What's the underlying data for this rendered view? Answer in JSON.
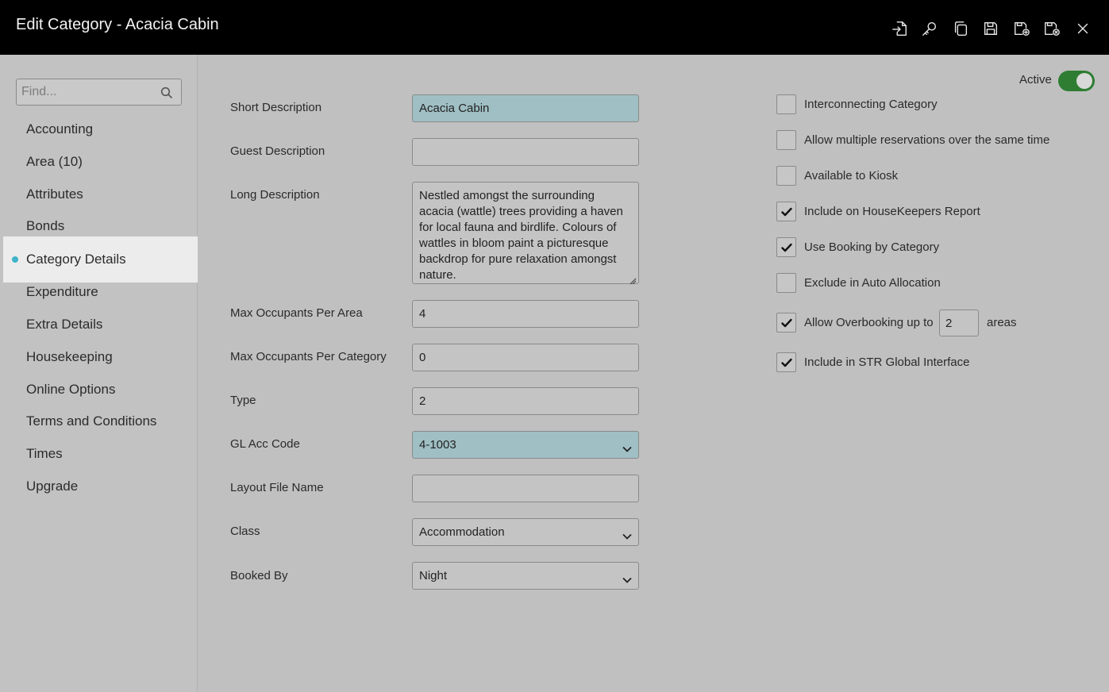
{
  "window": {
    "title": "Edit Category - Acacia Cabin"
  },
  "toolbar": {
    "icons": [
      "import-icon",
      "key-icon",
      "copy-icon",
      "save-icon",
      "save-and-new-icon",
      "save-and-close-icon",
      "close-icon"
    ]
  },
  "sidebar": {
    "search_placeholder": "Find...",
    "items": [
      {
        "label": "Accounting"
      },
      {
        "label": "Area (10)"
      },
      {
        "label": "Attributes"
      },
      {
        "label": "Bonds"
      },
      {
        "label": "Category Details",
        "active": true
      },
      {
        "label": "Expenditure"
      },
      {
        "label": "Extra Details"
      },
      {
        "label": "Housekeeping"
      },
      {
        "label": "Online Options"
      },
      {
        "label": "Terms and Conditions"
      },
      {
        "label": "Times"
      },
      {
        "label": "Upgrade"
      }
    ]
  },
  "form": {
    "short_description": {
      "label": "Short Description",
      "value": "Acacia Cabin"
    },
    "guest_description": {
      "label": "Guest Description",
      "value": ""
    },
    "long_description": {
      "label": "Long Description",
      "value": "Nestled amongst the surrounding acacia (wattle) trees providing a haven for local fauna and birdlife. Colours of wattles in bloom paint a picturesque backdrop for pure relaxation amongst nature."
    },
    "max_occupants_area": {
      "label": "Max Occupants Per Area",
      "value": "4"
    },
    "max_occupants_category": {
      "label": "Max Occupants Per Category",
      "value": "0"
    },
    "type": {
      "label": "Type",
      "value": "2"
    },
    "gl_acc_code": {
      "label": "GL Acc Code",
      "value": "4-1003"
    },
    "layout_file_name": {
      "label": "Layout File Name",
      "value": ""
    },
    "class": {
      "label": "Class",
      "value": "Accommodation"
    },
    "booked_by": {
      "label": "Booked By",
      "value": "Night"
    }
  },
  "options": {
    "active": {
      "label": "Active",
      "on": true
    },
    "interconnecting": {
      "label": "Interconnecting Category",
      "checked": false
    },
    "allow_multiple": {
      "label": "Allow multiple reservations over the same time",
      "checked": false
    },
    "kiosk": {
      "label": "Available to Kiosk",
      "checked": false
    },
    "housekeepers": {
      "label": "Include on HouseKeepers Report",
      "checked": true
    },
    "booking_by_category": {
      "label": "Use Booking by Category",
      "checked": true
    },
    "exclude_auto": {
      "label": "Exclude in Auto Allocation",
      "checked": false
    },
    "overbooking": {
      "label": "Allow Overbooking up to",
      "checked": true,
      "value": "2",
      "suffix": "areas"
    },
    "str_global": {
      "label": "Include in STR Global Interface",
      "checked": true
    }
  },
  "colors": {
    "header_bg": "#000000",
    "highlight_field": "#9fbfc4",
    "toggle_on": "#2e7d32",
    "active_dot": "#3fb3c9"
  }
}
